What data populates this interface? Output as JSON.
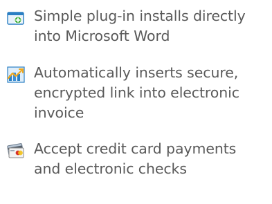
{
  "features": [
    {
      "icon": "plugin-window-icon",
      "lines": [
        "Simple plug-in installs directly",
        "into Microsoft Word"
      ]
    },
    {
      "icon": "chart-link-icon",
      "lines": [
        "Automatically inserts secure,",
        "encrypted link into electronic",
        "invoice"
      ]
    },
    {
      "icon": "credit-card-icon",
      "lines": [
        "Accept credit card payments",
        "and electronic checks"
      ]
    }
  ],
  "colors": {
    "text": "#5a5a5a",
    "window_blue": "#2b7fc3",
    "plugin_green": "#3fae3a",
    "card_red": "#d9332a",
    "card_yellow": "#f2c21b"
  }
}
